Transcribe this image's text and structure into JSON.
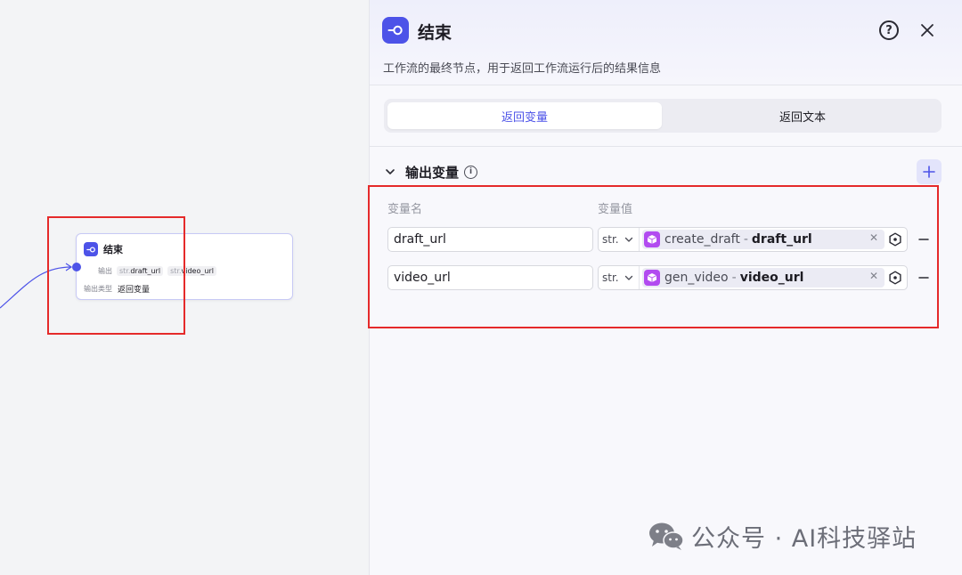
{
  "canvas": {
    "node": {
      "title": "结束",
      "output_label": "输出",
      "outputs": [
        {
          "type": "str.",
          "name": "draft_url"
        },
        {
          "type": "str.",
          "name": "video_url"
        }
      ],
      "output_type_label": "输出类型",
      "output_type_value": "返回变量"
    }
  },
  "panel": {
    "title": "结束",
    "description": "工作流的最终节点，用于返回工作流运行后的结果信息",
    "tabs": [
      {
        "label": "返回变量",
        "active": true
      },
      {
        "label": "返回文本",
        "active": false
      }
    ],
    "section_title": "输出变量",
    "col_name_label": "变量名",
    "col_value_label": "变量值",
    "variables": [
      {
        "name": "draft_url",
        "type": "str.",
        "ref_node": "create_draft",
        "sep": "-",
        "ref_var": "draft_url"
      },
      {
        "name": "video_url",
        "type": "str.",
        "ref_node": "gen_video",
        "sep": "-",
        "ref_var": "video_url"
      }
    ]
  },
  "watermark": {
    "text": "公众号 · AI科技驿站"
  },
  "colors": {
    "accent": "#4d53e8",
    "plugin": "#b24bf0",
    "highlight": "#e52a2a"
  }
}
